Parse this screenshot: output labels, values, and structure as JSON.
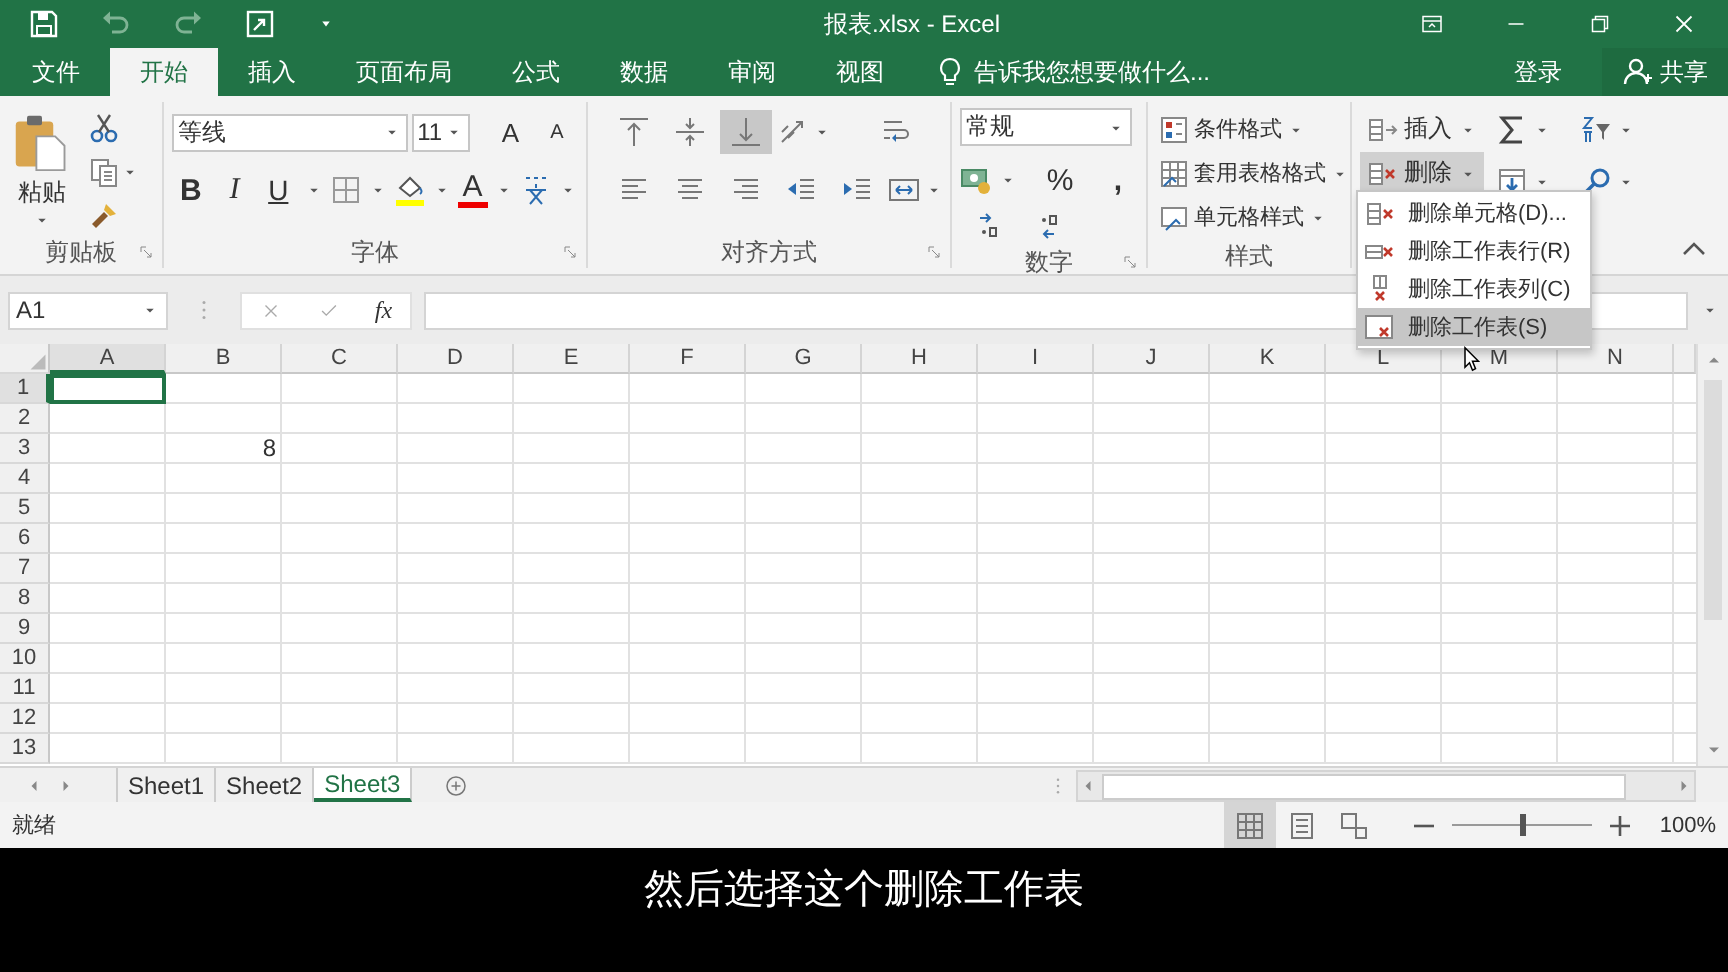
{
  "window": {
    "title": "报表.xlsx - Excel"
  },
  "tabs": [
    {
      "label": "文件",
      "selected": false
    },
    {
      "label": "开始",
      "selected": true
    },
    {
      "label": "插入",
      "selected": false
    },
    {
      "label": "页面布局",
      "selected": false
    },
    {
      "label": "公式",
      "selected": false
    },
    {
      "label": "数据",
      "selected": false
    },
    {
      "label": "审阅",
      "selected": false
    },
    {
      "label": "视图",
      "selected": false
    }
  ],
  "tell_me": {
    "placeholder": "告诉我您想要做什么..."
  },
  "account": {
    "sign_in": "登录",
    "share": "共享"
  },
  "ribbon": {
    "clipboard": {
      "label": "剪贴板",
      "paste": "粘贴"
    },
    "font": {
      "label": "字体",
      "name": "等线",
      "size": "11",
      "grow": "A",
      "shrink": "A",
      "bold": "B",
      "italic": "I",
      "underline": "U",
      "font_color": "A"
    },
    "alignment": {
      "label": "对齐方式",
      "vertical": [
        {
          "selected": false
        },
        {
          "selected": false
        },
        {
          "selected": true
        }
      ]
    },
    "number": {
      "label": "数字",
      "format": "常规",
      "percent": "%",
      "comma": ","
    },
    "styles": {
      "label": "样式",
      "buttons": [
        "条件格式",
        "套用表格格式",
        "单元格样式"
      ]
    },
    "cells": {
      "insert": "插入",
      "delete": "删除",
      "delete_expanded": true
    }
  },
  "menu": {
    "items": [
      {
        "label": "删除单元格(D)...",
        "selected": false
      },
      {
        "label": "删除工作表行(R)",
        "selected": false
      },
      {
        "label": "删除工作表列(C)",
        "selected": false
      },
      {
        "label": "删除工作表(S)",
        "selected": true
      }
    ]
  },
  "formula_bar": {
    "name_box": "A1",
    "fx": "fx"
  },
  "grid": {
    "columns": [
      {
        "label": "A",
        "selected": true
      },
      {
        "label": "B",
        "selected": false
      },
      {
        "label": "C",
        "selected": false
      },
      {
        "label": "D",
        "selected": false
      },
      {
        "label": "E",
        "selected": false
      },
      {
        "label": "F",
        "selected": false
      },
      {
        "label": "G",
        "selected": false
      },
      {
        "label": "H",
        "selected": false
      },
      {
        "label": "I",
        "selected": false
      },
      {
        "label": "J",
        "selected": false
      },
      {
        "label": "K",
        "selected": false
      },
      {
        "label": "L",
        "selected": false
      },
      {
        "label": "M",
        "selected": false
      },
      {
        "label": "N",
        "selected": false
      }
    ],
    "rows": [
      {
        "label": "1",
        "selected": true
      },
      {
        "label": "2",
        "selected": false
      },
      {
        "label": "3",
        "selected": false,
        "cells": [
          null,
          "8"
        ]
      },
      {
        "label": "4",
        "selected": false
      },
      {
        "label": "5",
        "selected": false
      },
      {
        "label": "6",
        "selected": false
      },
      {
        "label": "7",
        "selected": false
      },
      {
        "label": "8",
        "selected": false
      },
      {
        "label": "9",
        "selected": false
      },
      {
        "label": "10",
        "selected": false
      },
      {
        "label": "11",
        "selected": false
      },
      {
        "label": "12",
        "selected": false
      },
      {
        "label": "13",
        "selected": false
      }
    ]
  },
  "sheets": [
    {
      "label": "Sheet1",
      "selected": false
    },
    {
      "label": "Sheet2",
      "selected": false
    },
    {
      "label": "Sheet3",
      "selected": true
    }
  ],
  "status": {
    "text": "就绪",
    "views": [
      {
        "selected": true
      },
      {
        "selected": false
      },
      {
        "selected": false
      }
    ],
    "zoom": {
      "level": 0.5,
      "reading": "100%"
    }
  },
  "caption": "然后选择这个删除工作表"
}
